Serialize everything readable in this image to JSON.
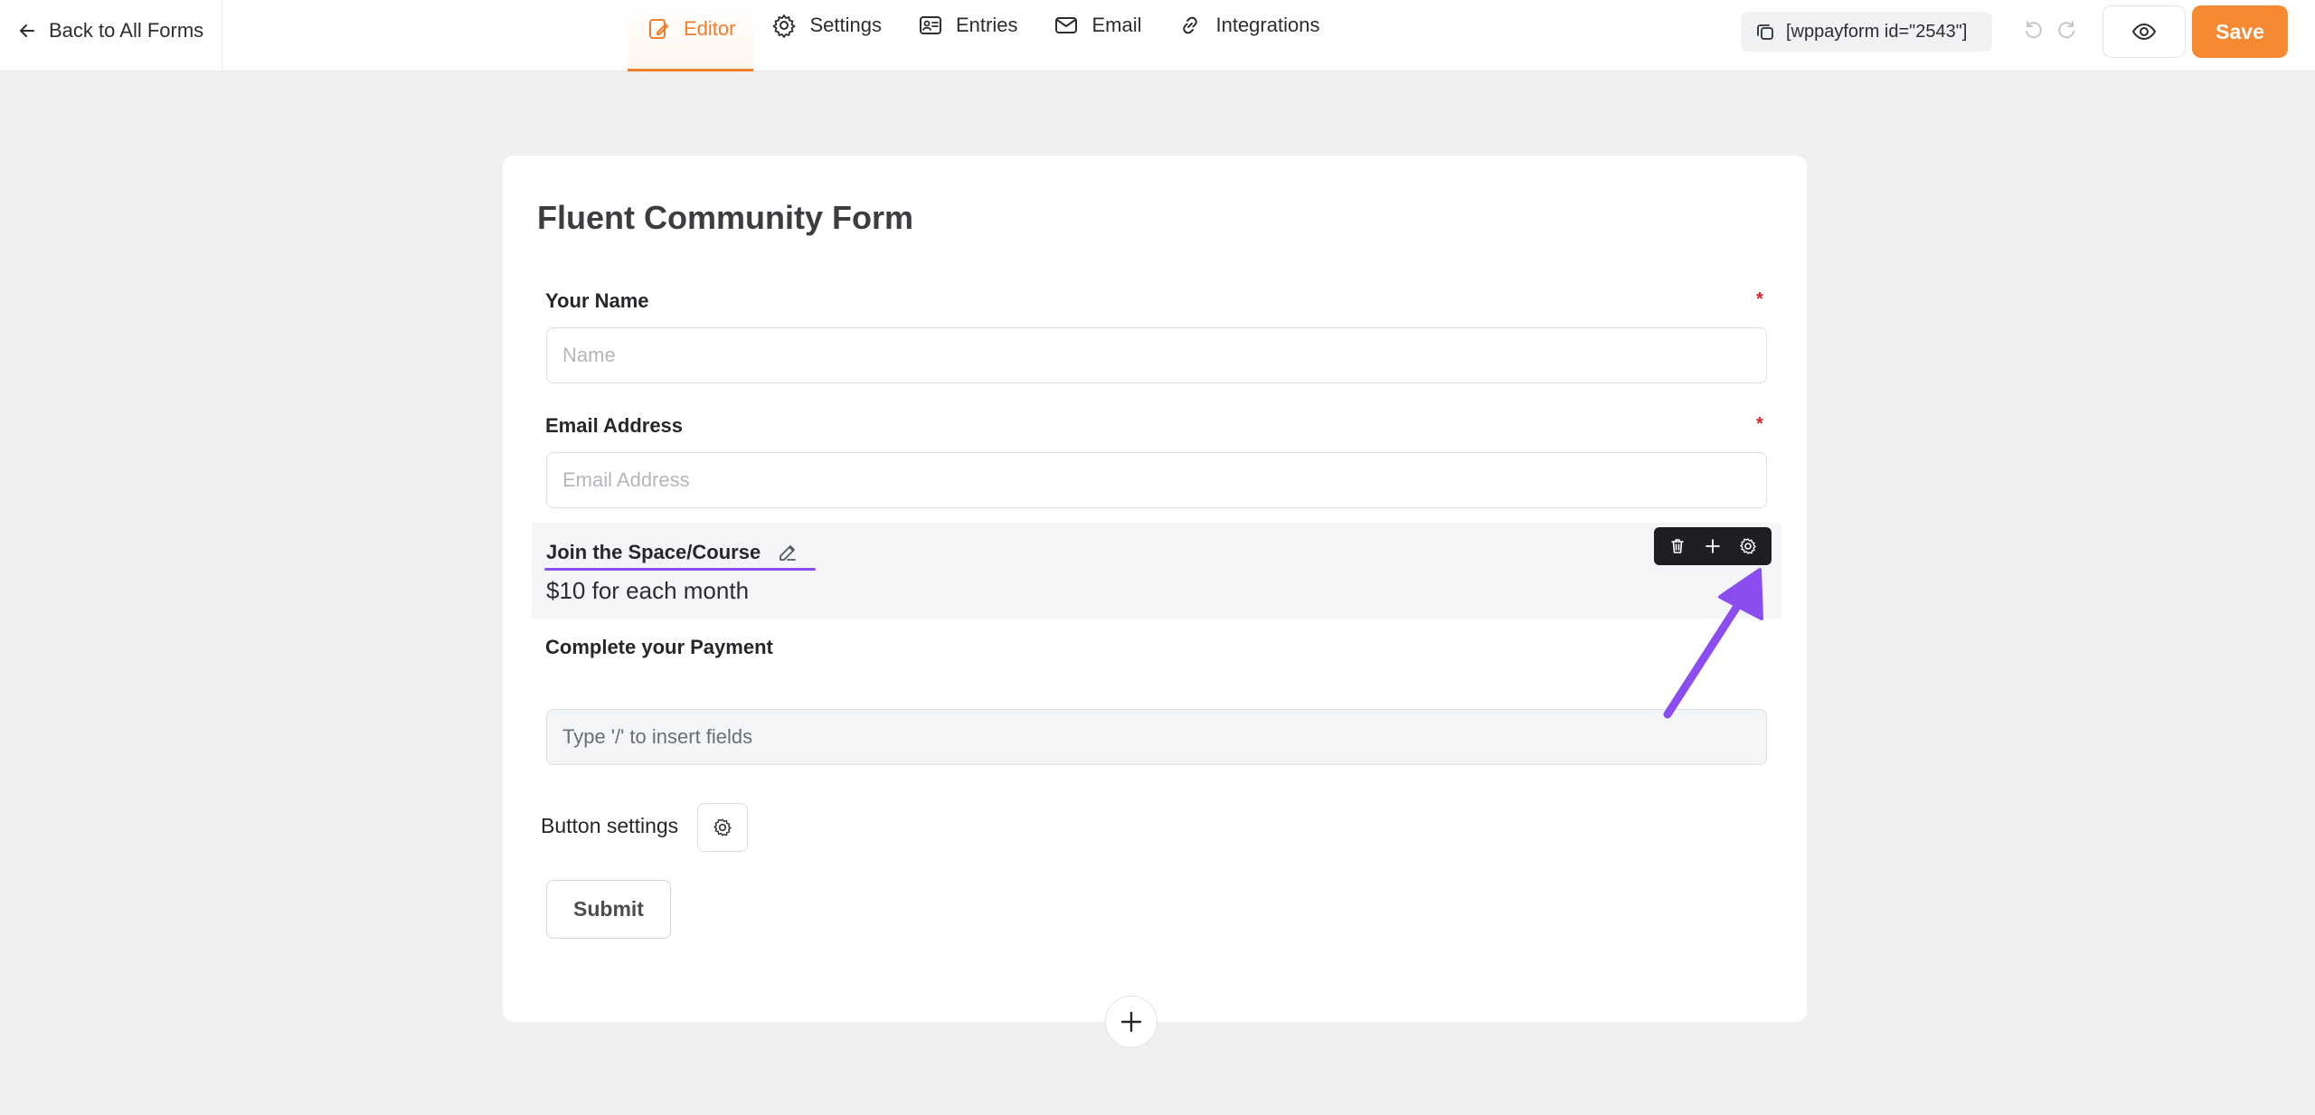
{
  "topbar": {
    "back_label": "Back to All Forms",
    "nav": [
      {
        "label": "Editor",
        "icon": "editor-icon"
      },
      {
        "label": "Settings",
        "icon": "gear-icon"
      },
      {
        "label": "Entries",
        "icon": "entries-icon"
      },
      {
        "label": "Email",
        "icon": "mail-icon"
      },
      {
        "label": "Integrations",
        "icon": "link-icon"
      }
    ],
    "shortcode": "[wppayform id=\"2543\"]",
    "save_label": "Save"
  },
  "form": {
    "title": "Fluent Community Form",
    "fields": [
      {
        "label": "Your Name",
        "placeholder": "Name",
        "required_mark": "*"
      },
      {
        "label": "Email Address",
        "placeholder": "Email Address",
        "required_mark": "*"
      }
    ],
    "selected_block": {
      "label": "Join the Space/Course",
      "price": "$10 for each month"
    },
    "payment_label": "Complete your Payment",
    "insert_placeholder": "Type '/' to insert fields",
    "button_settings_label": "Button settings",
    "submit_label": "Submit"
  },
  "colors": {
    "accent": "#f58a32",
    "annotation": "#8b4df0"
  }
}
